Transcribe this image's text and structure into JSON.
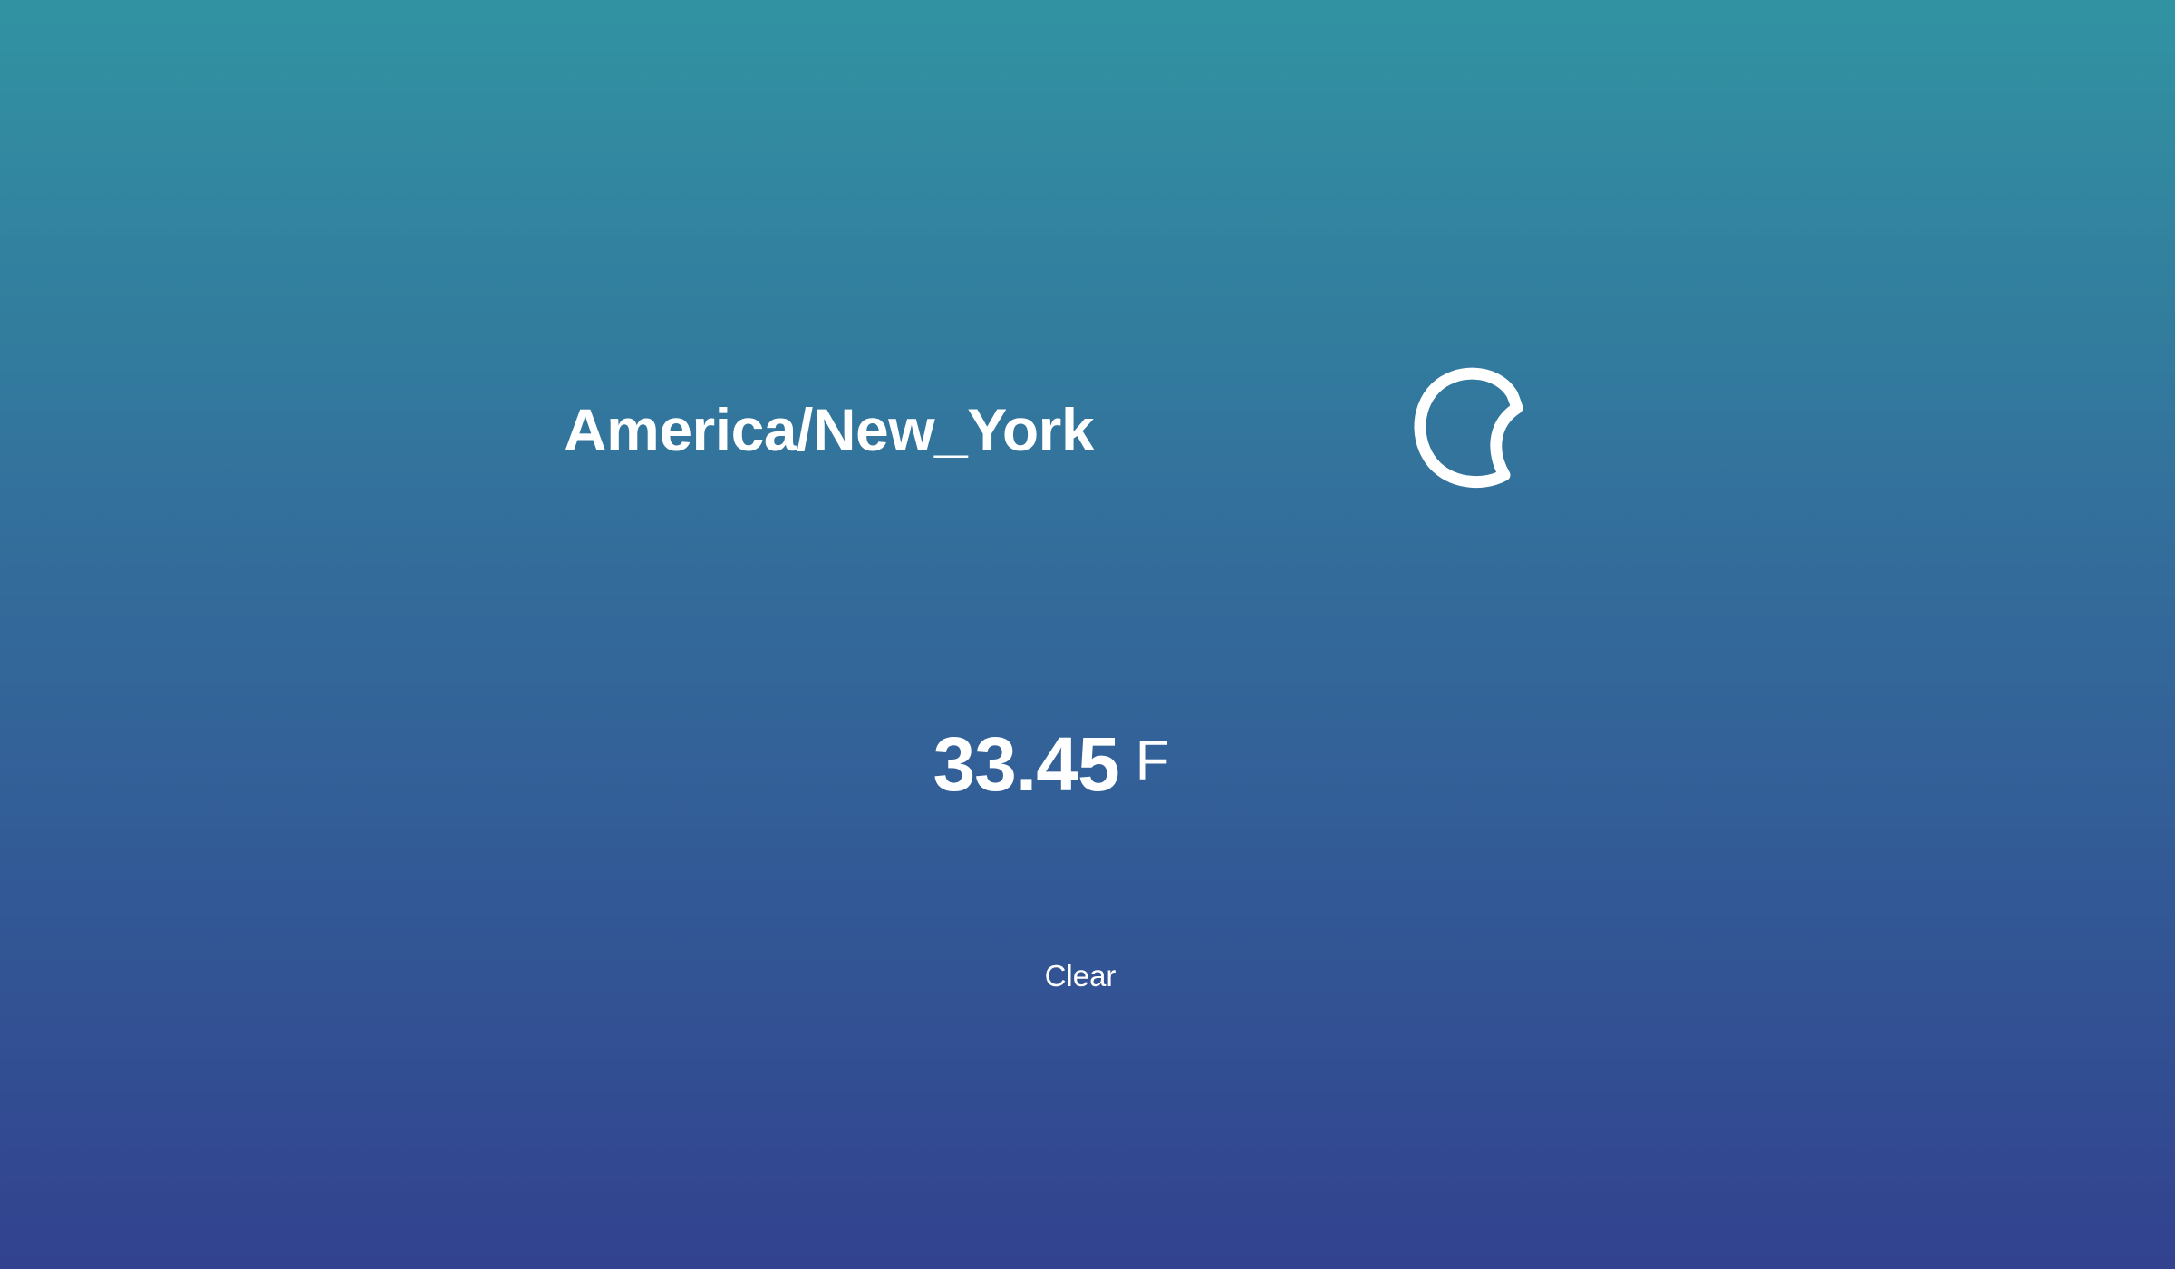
{
  "location": {
    "timezone": "America/New_York"
  },
  "weather": {
    "icon": "moon-icon",
    "temperature": "33.45",
    "unit": "F",
    "summary": "Clear"
  },
  "colors": {
    "gradient_top": "#3193a2",
    "gradient_middle": "#33709c",
    "gradient_bottom": "#32428f",
    "text": "#ffffff"
  }
}
